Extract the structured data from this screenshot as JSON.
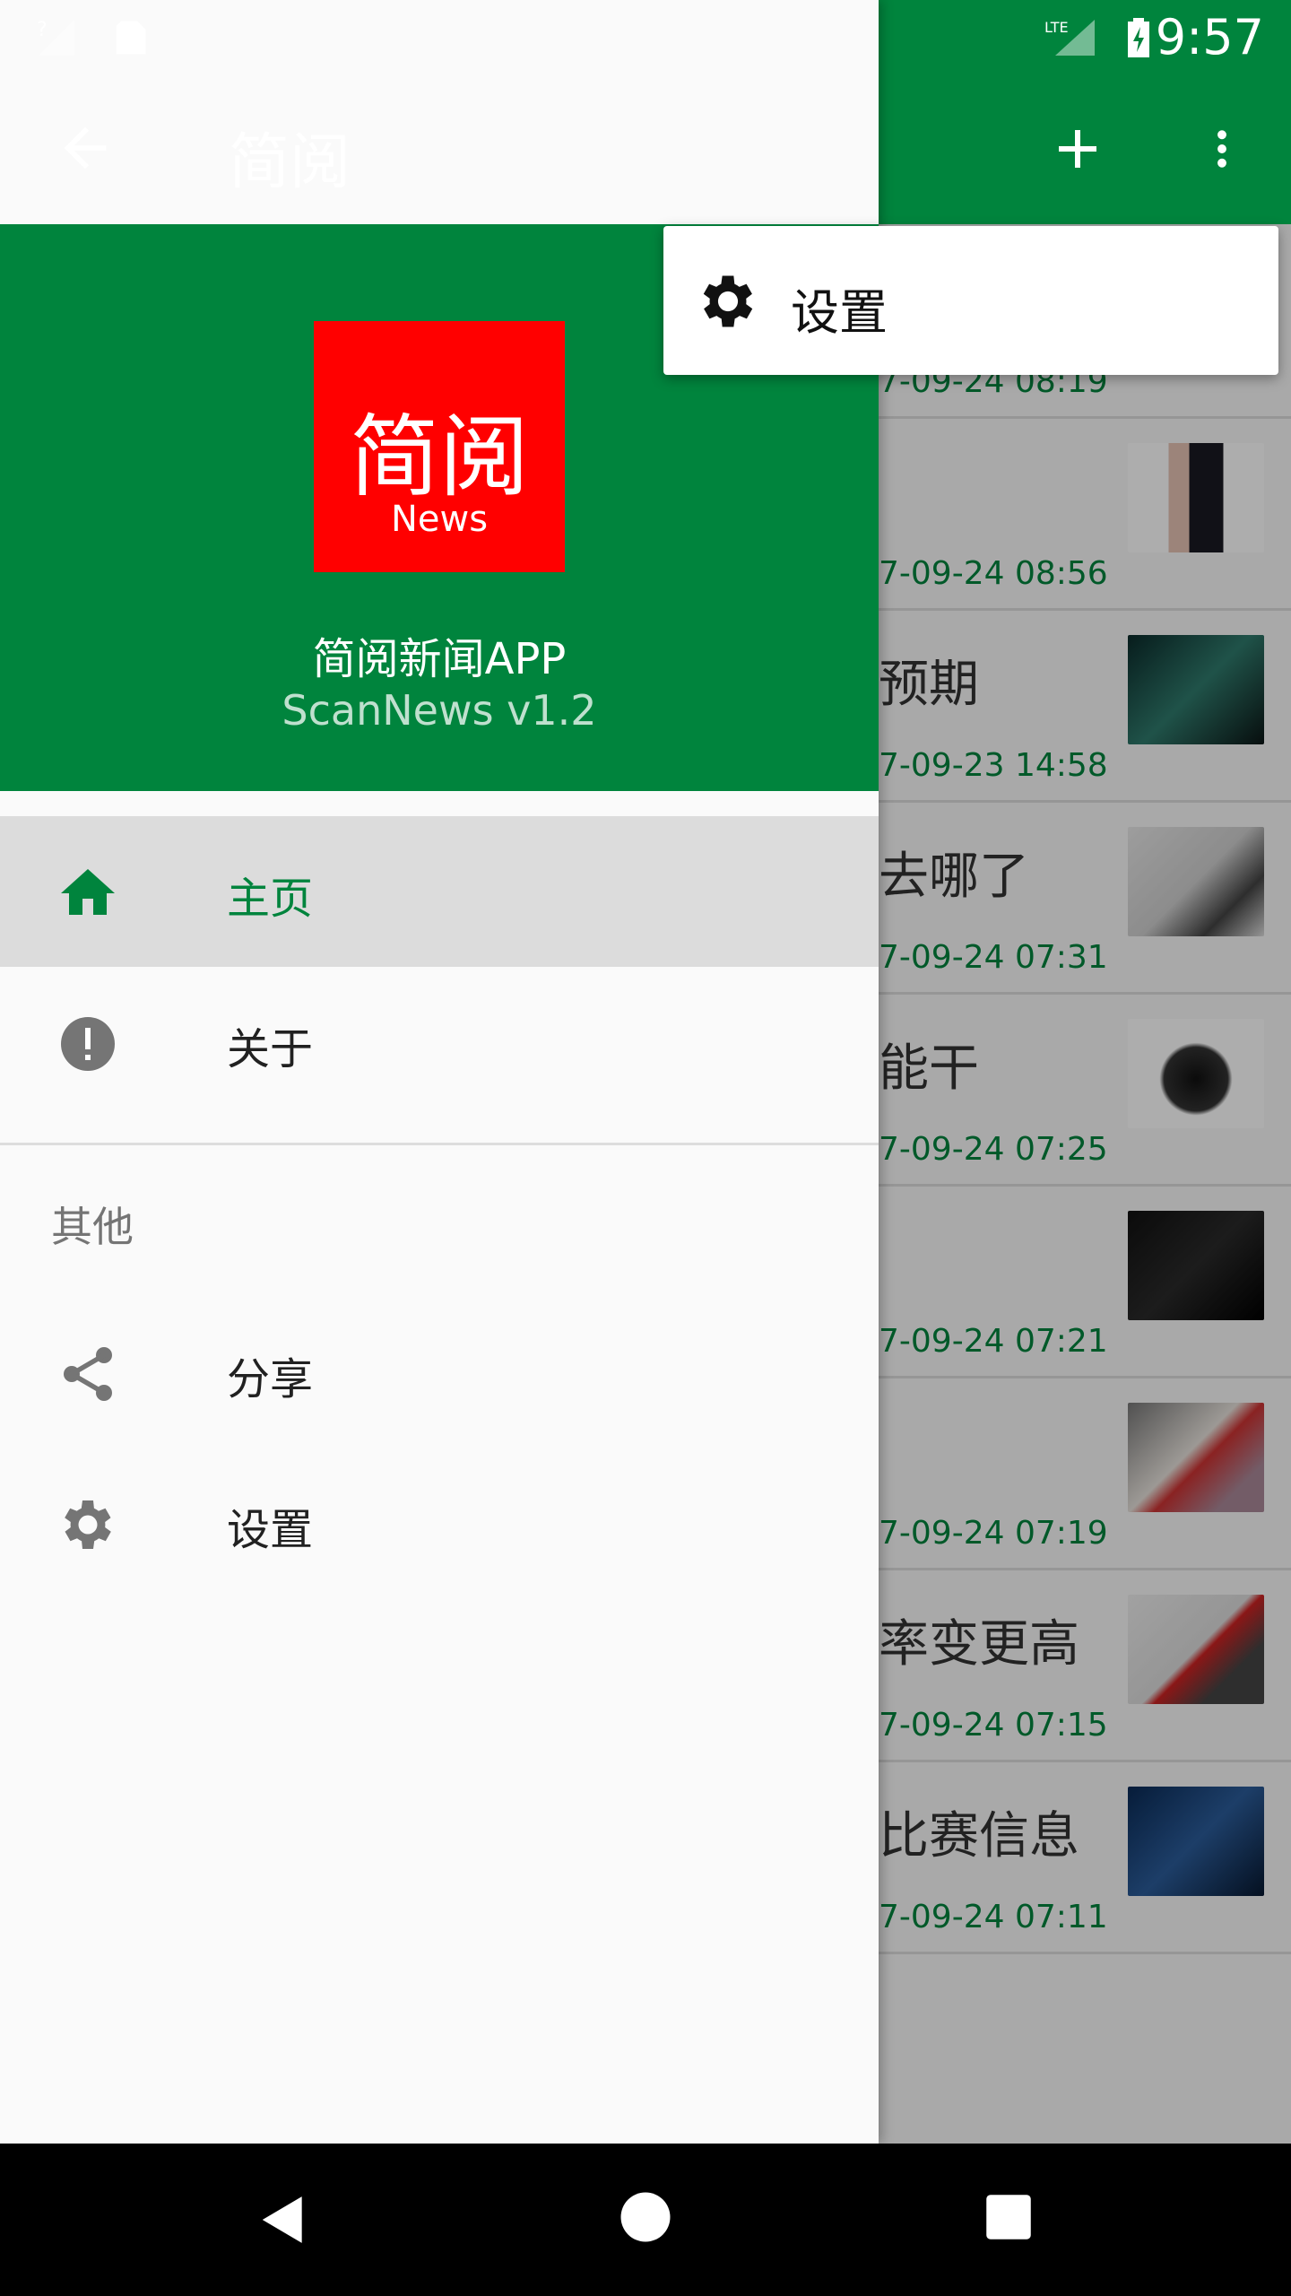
{
  "status_bar": {
    "time": "9:57",
    "network": "LTE"
  },
  "toolbar": {
    "title": "简阅"
  },
  "drawer": {
    "logo": {
      "text": "简阅",
      "sub": "News",
      "color": "#ff0000"
    },
    "app_name": "简阅新闻APP",
    "app_version": "ScanNews  v1.2",
    "items": [
      {
        "label": "主页",
        "icon": "home-icon",
        "selected": true
      },
      {
        "label": "关于",
        "icon": "info-icon",
        "selected": false
      }
    ],
    "section": "其他",
    "other_items": [
      {
        "label": "分享",
        "icon": "share-icon"
      },
      {
        "label": "设置",
        "icon": "gear-icon"
      }
    ]
  },
  "popup_menu": {
    "items": [
      {
        "label": "设置",
        "icon": "gear-icon"
      }
    ]
  },
  "news_list": [
    {
      "title": "",
      "date": "7-09-24 08:19"
    },
    {
      "title": "",
      "date": "7-09-24 08:56"
    },
    {
      "title": "预期",
      "date": "7-09-23 14:58"
    },
    {
      "title": "去哪了",
      "date": "7-09-24 07:31"
    },
    {
      "title": "能干",
      "date": "7-09-24 07:25"
    },
    {
      "title": "",
      "date": "7-09-24 07:21"
    },
    {
      "title": "",
      "date": "7-09-24 07:19"
    },
    {
      "title": "率变更高",
      "date": "7-09-24 07:15"
    },
    {
      "title": "比赛信息",
      "date": "7-09-24 07:11"
    }
  ],
  "colors": {
    "primary": "#00843d",
    "selected_bg": "#dcdcdc"
  }
}
